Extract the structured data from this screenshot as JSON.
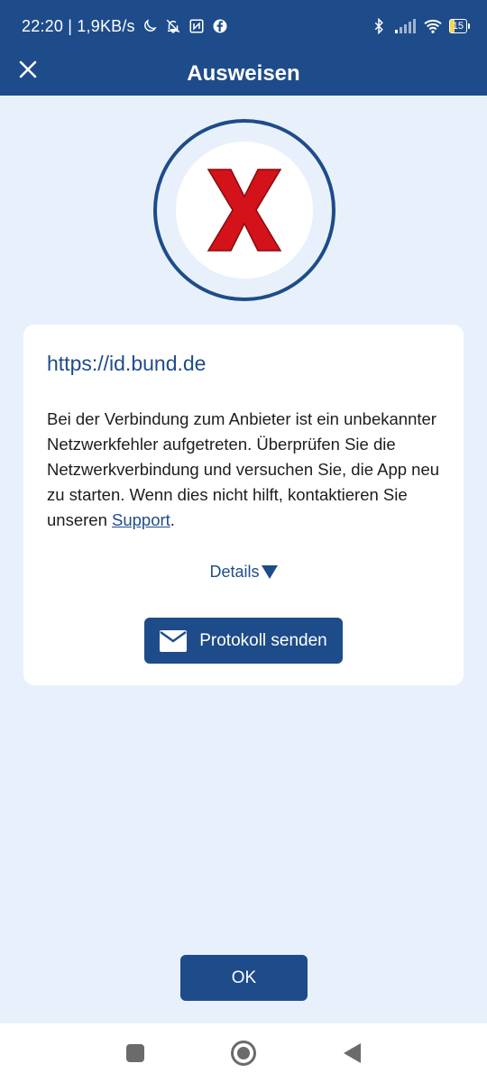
{
  "status_bar": {
    "time_and_speed": "22:20 | 1,9KB/s",
    "battery_level": "15",
    "icons": [
      "moon-icon",
      "bell-off-icon",
      "nfc-icon",
      "facebook-icon",
      "bluetooth-icon",
      "signal-icon",
      "wifi-icon",
      "battery-icon"
    ]
  },
  "app_bar": {
    "title": "Ausweisen",
    "close_icon": "close-icon"
  },
  "status_badge": {
    "icon": "error-x-icon",
    "color": "#d3121a"
  },
  "card": {
    "provider_url": "https://id.bund.de",
    "message_text": "Bei der Verbindung zum Anbieter ist ein unbekannter Netzwerkfehler aufgetreten. Überprüfen Sie die Netzwerkverbindung und versuchen Sie, die App neu zu starten. Wenn dies nicht hilft, kontaktieren Sie unseren ",
    "support_link": "Support",
    "message_end": ".",
    "details_label": "Details",
    "send_log_label": "Protokoll senden",
    "send_log_icon": "mail-icon"
  },
  "ok_label": "OK",
  "nav_bar": {
    "icons": [
      "recents-icon",
      "home-icon",
      "back-icon"
    ]
  },
  "colors": {
    "primary": "#1e4c8a",
    "background": "#e8f1fb",
    "error": "#d3121a"
  }
}
